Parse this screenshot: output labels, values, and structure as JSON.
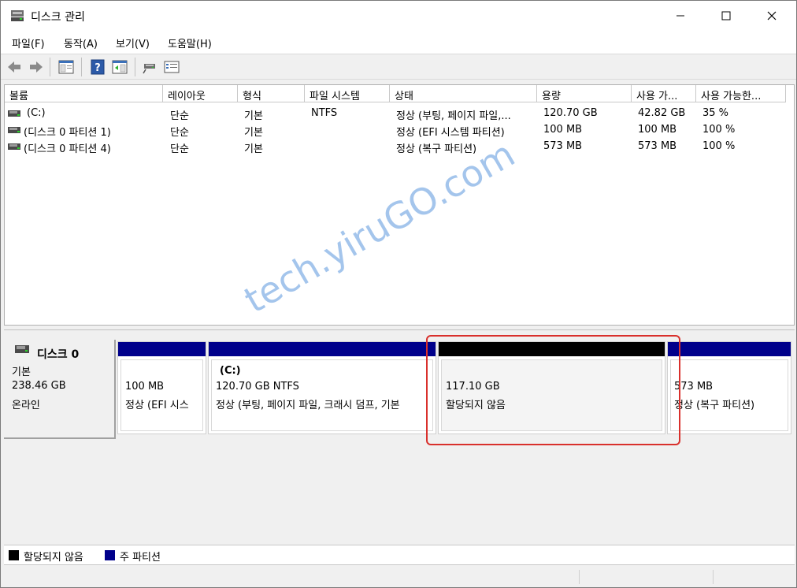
{
  "window": {
    "title": "디스크 관리"
  },
  "menu": {
    "items": [
      "파일(F)",
      "동작(A)",
      "보기(V)",
      "도움말(H)"
    ]
  },
  "toolbar": {
    "icons": [
      "back-icon",
      "forward-icon",
      "properties-icon",
      "help-icon",
      "show-hide-icon",
      "connect-icon",
      "volume-list-icon"
    ]
  },
  "columns": [
    "볼륨",
    "레이아웃",
    "형식",
    "파일 시스템",
    "상태",
    "용량",
    "사용 가...",
    "사용 가능한..."
  ],
  "volumes": [
    {
      "name": "(C:)",
      "layout": "단순",
      "type": "기본",
      "fs": "NTFS",
      "status": "정상 (부팅, 페이지 파일,...",
      "capacity": "120.70 GB",
      "free": "42.82 GB",
      "pct": "35 %"
    },
    {
      "name": "(디스크 0 파티션 1)",
      "layout": "단순",
      "type": "기본",
      "fs": "",
      "status": "정상 (EFI 시스템 파티션)",
      "capacity": "100 MB",
      "free": "100 MB",
      "pct": "100 %"
    },
    {
      "name": "(디스크 0 파티션 4)",
      "layout": "단순",
      "type": "기본",
      "fs": "",
      "status": "정상 (복구 파티션)",
      "capacity": "573 MB",
      "free": "573 MB",
      "pct": "100 %"
    }
  ],
  "disk": {
    "name": "디스크 0",
    "type": "기본",
    "size": "238.46 GB",
    "state": "온라인"
  },
  "partitions": [
    {
      "title": "",
      "size": "100 MB",
      "status": "정상 (EFI 시스"
    },
    {
      "title": "(C:)",
      "size": "120.70 GB NTFS",
      "status": "정상 (부팅, 페이지 파일, 크래시 덤프, 기본"
    },
    {
      "title": "",
      "size": "117.10 GB",
      "status": "할당되지 않음"
    },
    {
      "title": "",
      "size": "573 MB",
      "status": "정상 (복구 파티션)"
    }
  ],
  "legend": {
    "unallocated": "할당되지 않음",
    "primary": "주 파티션"
  },
  "watermark": "tech.yiruGO.com",
  "colors": {
    "primary": "#00008b",
    "unallocated": "#000000",
    "highlight": "#d9302c"
  }
}
